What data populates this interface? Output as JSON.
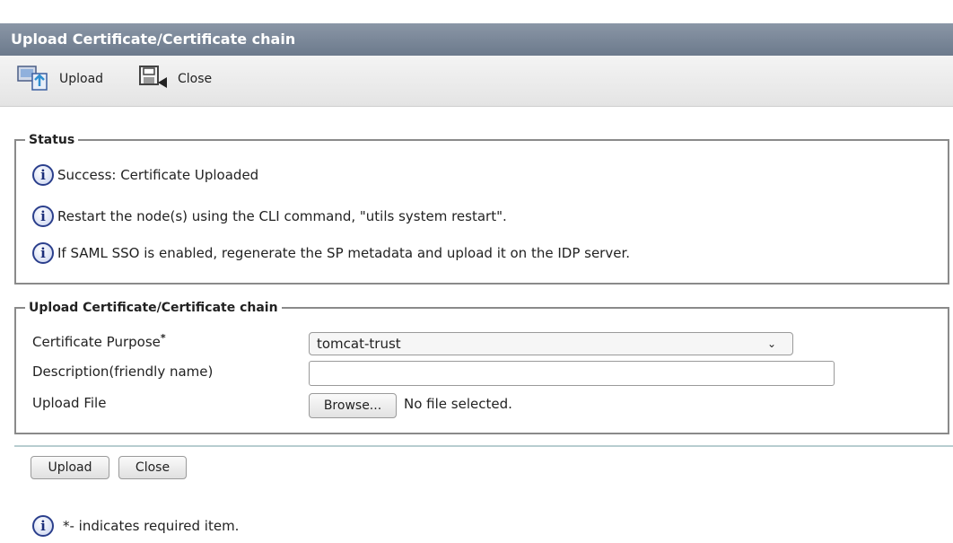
{
  "window": {
    "title": "Upload Certificate/Certificate chain"
  },
  "toolbar": {
    "upload_label": "Upload",
    "close_label": "Close"
  },
  "status": {
    "legend": "Status",
    "messages": [
      "Success: Certificate Uploaded",
      "Restart the node(s) using the CLI command, \"utils system restart\".",
      "If SAML SSO is enabled, regenerate the SP metadata and upload it on the IDP server."
    ]
  },
  "upload_form": {
    "legend": "Upload Certificate/Certificate chain",
    "purpose_label": "Certificate Purpose",
    "required_mark": "*",
    "purpose_value": "tomcat-trust",
    "description_label": "Description(friendly name)",
    "description_value": "",
    "file_label": "Upload File",
    "browse_label": "Browse...",
    "file_status": "No file selected."
  },
  "actions": {
    "upload_label": "Upload",
    "close_label": "Close"
  },
  "footer": {
    "required_note": "*- indicates required item."
  },
  "icons": {
    "info": "info-icon",
    "upload": "upload-icon",
    "close": "close-icon"
  },
  "colors": {
    "titlebar": "#7a8798",
    "info_blue": "#2b3f8c"
  }
}
